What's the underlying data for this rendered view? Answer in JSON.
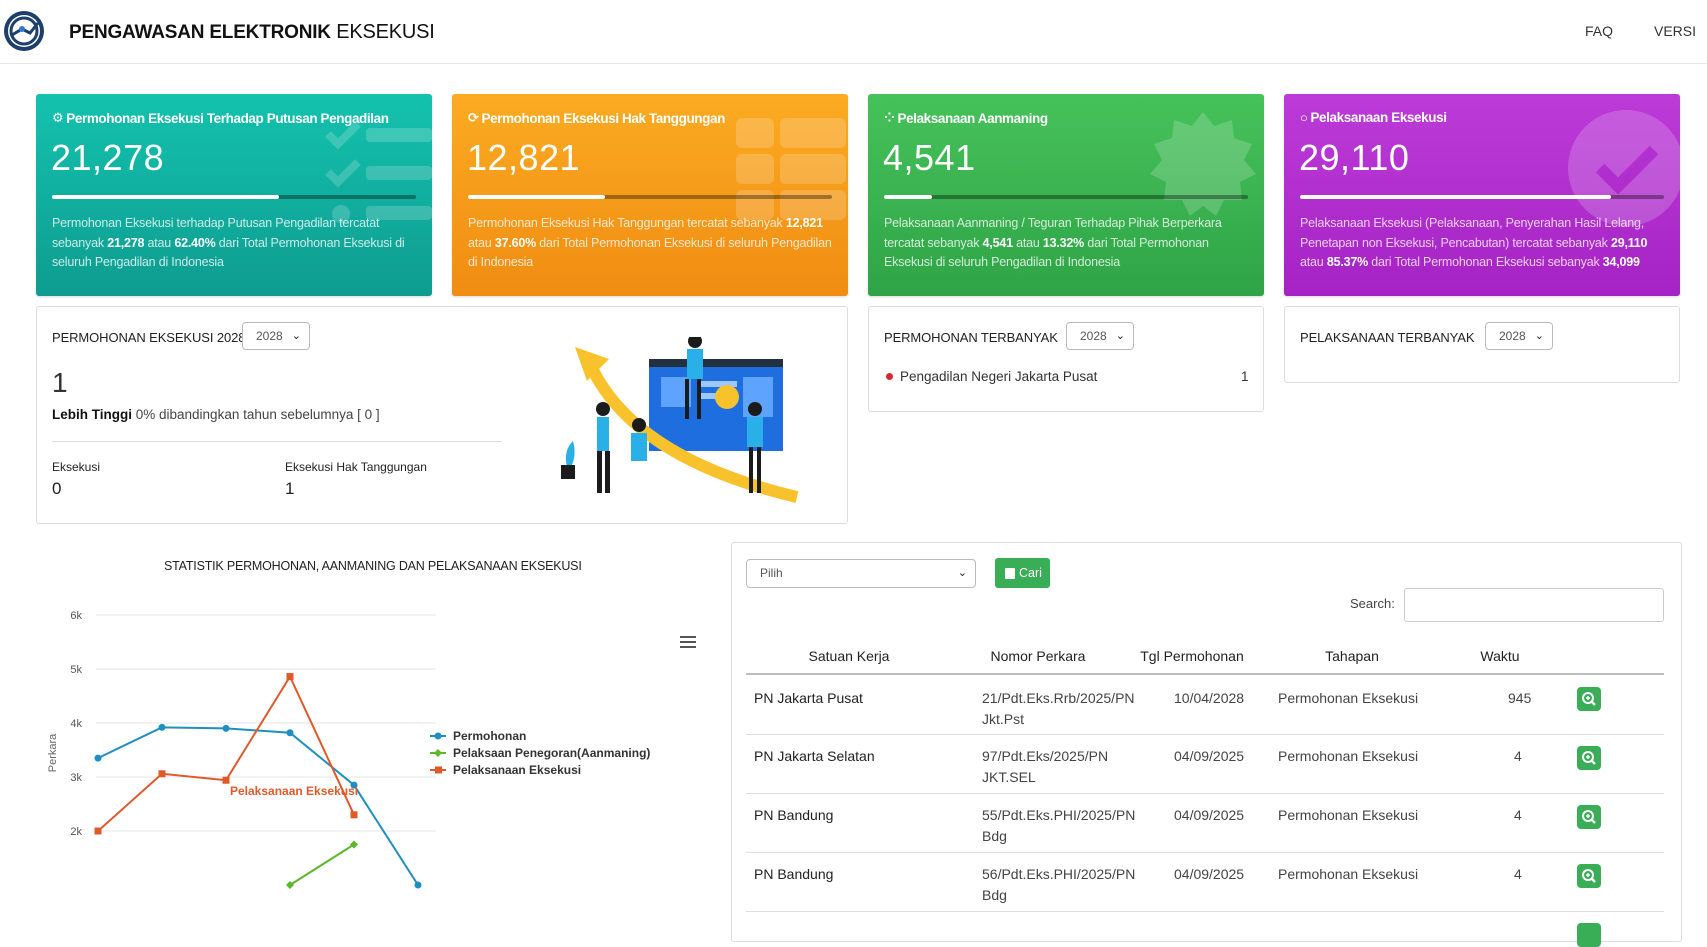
{
  "header": {
    "title_bold": "PENGAWASAN ELEKTRONIK",
    "title_light": "EKSEKUSI",
    "nav": [
      "FAQ",
      "VERSI"
    ]
  },
  "cards": [
    {
      "title": "Permohonan Eksekusi Terhadap Putusan Pengadilan",
      "value": "21,278",
      "progress": 0.624,
      "desc_parts": [
        "Permohonan Eksekusi terhadap Putusan Pengadilan tercatat sebanyak ",
        "21,278",
        " atau ",
        "62.40%",
        " dari Total Permohonan Eksekusi di seluruh Pengadilan di Indonesia"
      ],
      "color": "#12b5a6",
      "icon": "gear-icon"
    },
    {
      "title": "Permohonan Eksekusi Hak Tanggungan",
      "value": "12,821",
      "progress": 0.376,
      "desc_parts": [
        "Permohonan Eksekusi Hak Tanggungan tercatat sebanyak ",
        "12,821",
        " atau ",
        "37.60%",
        " dari Total Permohonan Eksekusi di seluruh Pengadilan di Indonesia"
      ],
      "color": "#f5a11c",
      "icon": "refresh-icon"
    },
    {
      "title": "Pelaksanaan Aanmaning",
      "value": "4,541",
      "progress": 0.1332,
      "desc_parts": [
        "Pelaksanaan Aanmaning / Teguran Terhadap Pihak Berperkara tercatat sebanyak ",
        "4,541",
        " atau ",
        "13.32%",
        " dari Total Permohonan Eksekusi di seluruh Pengadilan di Indonesia"
      ],
      "color": "#3bb54f",
      "icon": "spinner-icon"
    },
    {
      "title": "Pelaksanaan Eksekusi",
      "value": "29,110",
      "progress": 0.8537,
      "desc_parts": [
        "Pelaksanaan Eksekusi (Pelaksanaan, Penyerahan Hasil Lelang, Penetapan non Eksekusi, Pencabutan) tercatat sebanyak ",
        "29,110",
        " atau ",
        "85.37%",
        " dari Total Permohonan Eksekusi sebanyak ",
        "34,099"
      ],
      "color": "#b02fcf",
      "icon": "circle-icon"
    }
  ],
  "permohonan_panel": {
    "title": "PERMOHONAN EKSEKUSI 2028",
    "year": "2028",
    "value": "1",
    "compare_bold": "Lebih Tinggi",
    "compare_text": " 0% dibandingkan tahun sebelumnya [ 0 ]",
    "stats": [
      {
        "label": "Eksekusi",
        "value": "0"
      },
      {
        "label": "Eksekusi Hak Tanggungan",
        "value": "1"
      }
    ]
  },
  "terbanyak_panel": {
    "title": "PERMOHONAN TERBANYAK",
    "year": "2028",
    "items": [
      {
        "name": "Pengadilan Negeri Jakarta Pusat",
        "count": "1"
      }
    ]
  },
  "pelaksanaan_panel": {
    "title": "PELAKSANAAN TERBANYAK",
    "year": "2028"
  },
  "chart_data": {
    "type": "line",
    "title": "STATISTIK PERMOHONAN, AANMANING DAN PELAKSANAAN EKSEKUSI",
    "ylabel": "Perkara",
    "yticks": [
      "2k",
      "3k",
      "4k",
      "5k",
      "6k"
    ],
    "ylim": [
      2000,
      6000
    ],
    "series": [
      {
        "name": "Permohonan",
        "color": "#1f8fc0",
        "values": [
          3350,
          3920,
          3900,
          3820,
          2850,
          1000
        ]
      },
      {
        "name": "Pelaksaan Penegoran(Aanmaning)",
        "color": "#5cb82a",
        "values": [
          null,
          null,
          null,
          1000,
          1750,
          null
        ]
      },
      {
        "name": "Pelaksanaan Eksekusi",
        "color": "#e0592a",
        "values": [
          2000,
          3060,
          2940,
          4860,
          2300,
          null
        ]
      }
    ],
    "annotation": "Pelaksanaan Eksekusi",
    "legend": "right",
    "grid": true
  },
  "table": {
    "select_placeholder": "Pilih",
    "search_button": "Cari",
    "search_label": "Search:",
    "columns": [
      "Satuan Kerja",
      "Nomor Perkara",
      "Tgl Permohonan",
      "Tahapan",
      "Waktu"
    ],
    "rows": [
      {
        "satker": "PN Jakarta Pusat",
        "nomor": [
          "21/Pdt.Eks.Rrb/2025/PN",
          "Jkt.Pst"
        ],
        "tgl": "10/04/2028",
        "tahapan": "Permohonan Eksekusi",
        "waktu": "945"
      },
      {
        "satker": "PN Jakarta Selatan",
        "nomor": [
          "97/Pdt.Eks/2025/PN",
          "JKT.SEL"
        ],
        "tgl": "04/09/2025",
        "tahapan": "Permohonan Eksekusi",
        "waktu": "4"
      },
      {
        "satker": "PN Bandung",
        "nomor": [
          "55/Pdt.Eks.PHI/2025/PN",
          "Bdg"
        ],
        "tgl": "04/09/2025",
        "tahapan": "Permohonan Eksekusi",
        "waktu": "4"
      },
      {
        "satker": "PN Bandung",
        "nomor": [
          "56/Pdt.Eks.PHI/2025/PN",
          "Bdg"
        ],
        "tgl": "04/09/2025",
        "tahapan": "Permohonan Eksekusi",
        "waktu": "4"
      }
    ]
  }
}
